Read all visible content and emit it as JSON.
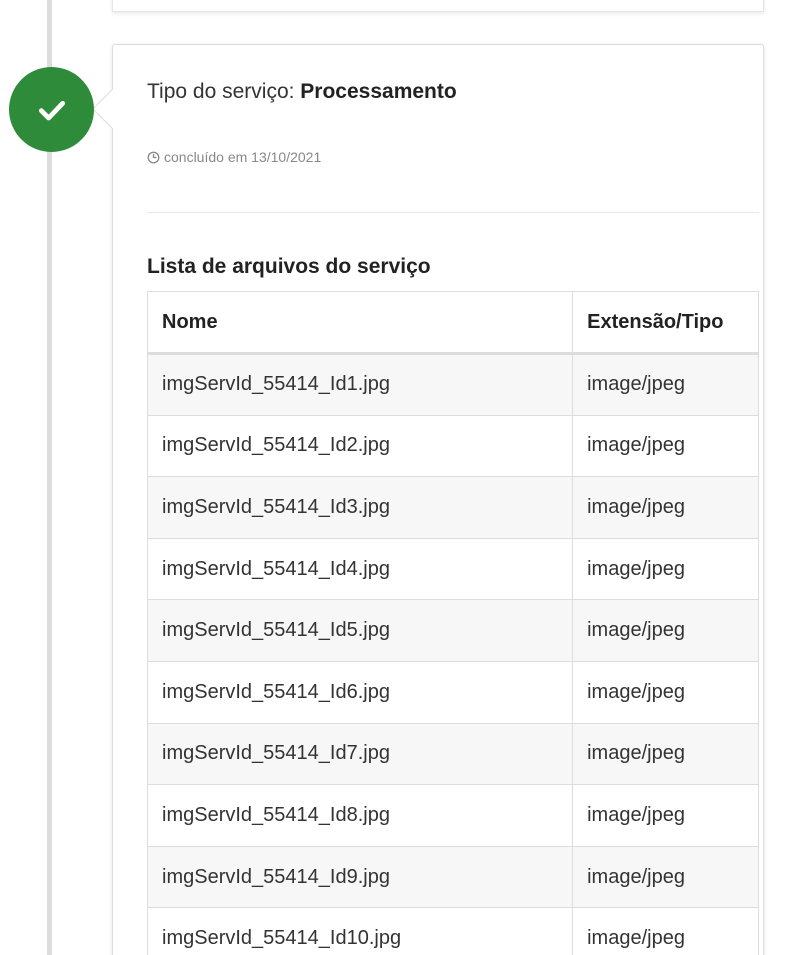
{
  "colors": {
    "badge": "#2e8b3a",
    "timeline": "#dddddd",
    "row_striped": "#f7f7f7"
  },
  "service": {
    "type_label": "Tipo do serviço:",
    "type_value": "Processamento",
    "status_icon": "clock-icon",
    "status_text": "concluído em 13/10/2021",
    "badge_icon": "check-icon"
  },
  "files": {
    "title": "Lista de arquivos do serviço",
    "columns": [
      "Nome",
      "Extensão/Tipo"
    ],
    "rows": [
      {
        "name": "imgServId_55414_Id1.jpg",
        "type": "image/jpeg"
      },
      {
        "name": "imgServId_55414_Id2.jpg",
        "type": "image/jpeg"
      },
      {
        "name": "imgServId_55414_Id3.jpg",
        "type": "image/jpeg"
      },
      {
        "name": "imgServId_55414_Id4.jpg",
        "type": "image/jpeg"
      },
      {
        "name": "imgServId_55414_Id5.jpg",
        "type": "image/jpeg"
      },
      {
        "name": "imgServId_55414_Id6.jpg",
        "type": "image/jpeg"
      },
      {
        "name": "imgServId_55414_Id7.jpg",
        "type": "image/jpeg"
      },
      {
        "name": "imgServId_55414_Id8.jpg",
        "type": "image/jpeg"
      },
      {
        "name": "imgServId_55414_Id9.jpg",
        "type": "image/jpeg"
      },
      {
        "name": "imgServId_55414_Id10.jpg",
        "type": "image/jpeg"
      }
    ]
  }
}
